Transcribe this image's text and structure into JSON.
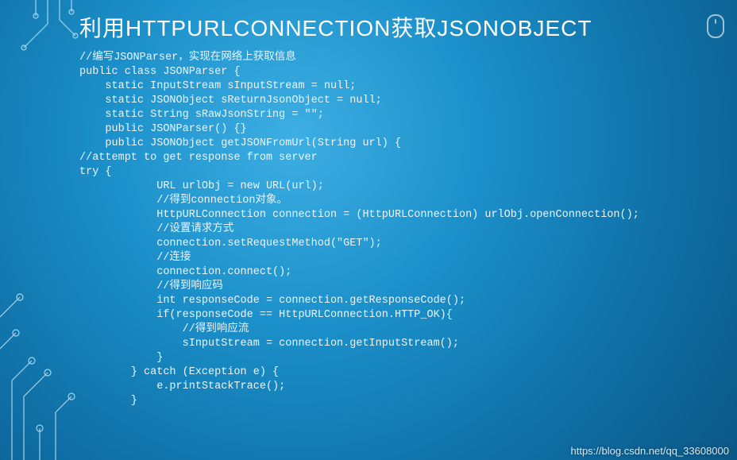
{
  "title": "利用HTTPURLCONNECTION获取JSONOBJECT",
  "code": "//编写JSONParser，实现在网络上获取信息\npublic class JSONParser {\n    static InputStream sInputStream = null;\n    static JSONObject sReturnJsonObject = null;\n    static String sRawJsonString = \"\";\n    public JSONParser() {}\n    public JSONObject getJSONFromUrl(String url) {\n//attempt to get response from server\ntry {\n            URL urlObj = new URL(url);\n            //得到connection对象。\n            HttpURLConnection connection = (HttpURLConnection) urlObj.openConnection();\n            //设置请求方式\n            connection.setRequestMethod(\"GET\");\n            //连接\n            connection.connect();\n            //得到响应码\n            int responseCode = connection.getResponseCode();\n            if(responseCode == HttpURLConnection.HTTP_OK){\n                //得到响应流\n                sInputStream = connection.getInputStream();\n            }\n        } catch (Exception e) {\n            e.printStackTrace();\n        }",
  "watermark": "https://blog.csdn.net/qq_33608000"
}
